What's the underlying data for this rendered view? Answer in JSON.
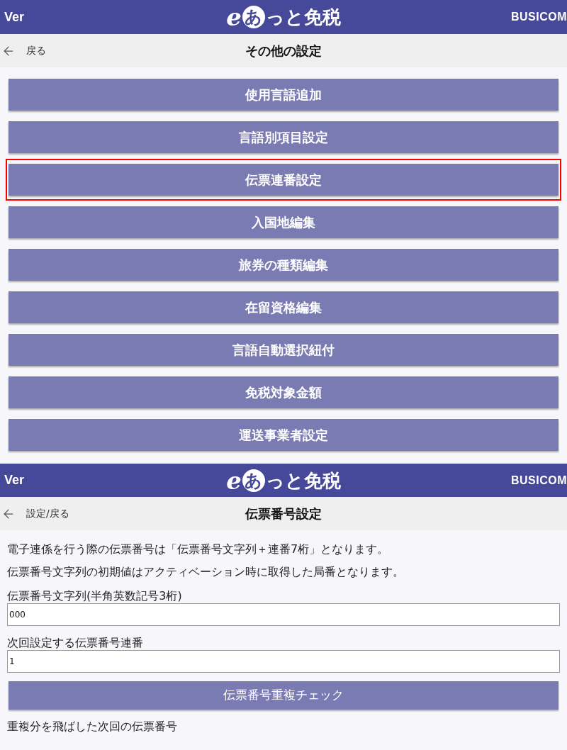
{
  "screens": [
    {
      "kind": "menu",
      "header": {
        "version": "Ver",
        "logo": [
          {
            "kind": "letter",
            "text": "e"
          },
          {
            "kind": "bubble",
            "text": "あ"
          },
          {
            "kind": "plain",
            "text": "っと免税"
          }
        ],
        "brand": "BUSICOM"
      },
      "nav": {
        "back": "戻る",
        "title": "その他の設定"
      },
      "items": [
        {
          "label": "使用言語追加",
          "highlighted": false
        },
        {
          "label": "言語別項目設定",
          "highlighted": false
        },
        {
          "label": "伝票連番設定",
          "highlighted": true
        },
        {
          "label": "入国地編集",
          "highlighted": false
        },
        {
          "label": "旅券の種類編集",
          "highlighted": false
        },
        {
          "label": "在留資格編集",
          "highlighted": false
        },
        {
          "label": "言語自動選択紐付",
          "highlighted": false
        },
        {
          "label": "免税対象金額",
          "highlighted": false
        },
        {
          "label": "運送事業者設定",
          "highlighted": false
        }
      ]
    },
    {
      "kind": "form",
      "header": {
        "version": "Ver",
        "logo": [
          {
            "kind": "letter",
            "text": "e"
          },
          {
            "kind": "bubble",
            "text": "あ"
          },
          {
            "kind": "plain",
            "text": "っと免税"
          }
        ],
        "brand": "BUSICOM"
      },
      "nav": {
        "back": "設定/戻る",
        "title": "伝票番号設定"
      },
      "notes": [
        "電子連係を行う際の伝票番号は「伝票番号文字列＋連番7桁」となります。",
        "伝票番号文字列の初期値はアクティベーション時に取得した局番となります。"
      ],
      "fields": [
        {
          "label": "伝票番号文字列(半角英数記号3桁)",
          "value": "000"
        },
        {
          "label": "次回設定する伝票番号連番",
          "value": "1"
        }
      ],
      "button": "伝票番号重複チェック",
      "result_label": "重複分を飛ばした次回の伝票番号"
    }
  ]
}
